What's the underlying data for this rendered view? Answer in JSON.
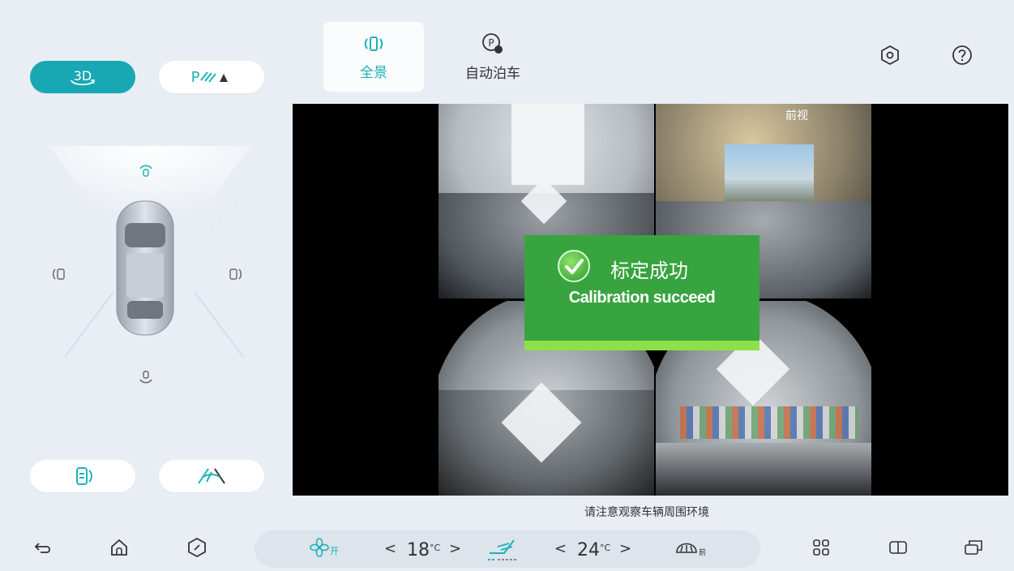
{
  "modes": {
    "three_d_label": "3D",
    "parking_label": "P"
  },
  "tabs": [
    {
      "label": "全景",
      "active": true
    },
    {
      "label": "自动泊车",
      "active": false
    }
  ],
  "camera": {
    "front_view_label": "前视",
    "toast": {
      "title_cn": "标定成功",
      "title_en": "Calibration succeed"
    },
    "notice": "请注意观察车辆周围环境"
  },
  "climate": {
    "fan_label": "开",
    "left_temp": "18",
    "right_temp": "24",
    "unit": "°C",
    "defrost_label": "前"
  },
  "colors": {
    "accent": "#17a8b3",
    "success_green": "#38a43f",
    "background": "#e9eef5"
  },
  "icons": [
    "back-icon",
    "home-icon",
    "settings-icon",
    "fan-icon",
    "seat-heat-icon",
    "defrost-icon",
    "apps-icon",
    "split-screen-icon",
    "window-switch-icon",
    "help-icon"
  ]
}
